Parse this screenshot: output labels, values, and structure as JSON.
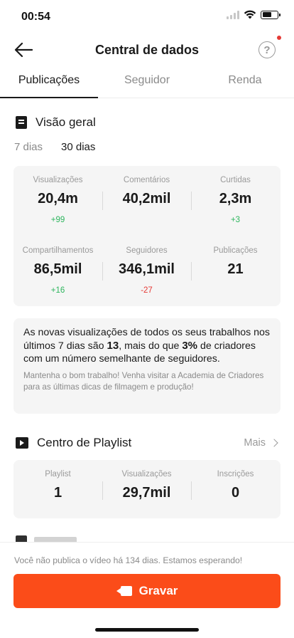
{
  "status": {
    "time": "00:54",
    "wifi_icon": "wifi-icon",
    "battery_icon": "battery-icon"
  },
  "nav": {
    "title": "Central de dados",
    "back_icon": "arrow-left-icon",
    "help_icon": "help-circle-icon",
    "help_symbol": "?"
  },
  "tabs": [
    {
      "label": "Publicações",
      "active": true
    },
    {
      "label": "Seguidor",
      "active": false
    },
    {
      "label": "Renda",
      "active": false
    }
  ],
  "overview": {
    "title": "Visão geral",
    "periods": [
      {
        "label": "7 dias",
        "active": false
      },
      {
        "label": "30 dias",
        "active": true
      }
    ],
    "stats": [
      {
        "label": "Visualizações",
        "value": "20,4m",
        "delta": "+99"
      },
      {
        "label": "Comentários",
        "value": "40,2mil",
        "delta": ""
      },
      {
        "label": "Curtidas",
        "value": "2,3m",
        "delta": "+3"
      },
      {
        "label": "Compartilhamentos",
        "value": "86,5mil",
        "delta": "+16"
      },
      {
        "label": "Seguidores",
        "value": "346,1mil",
        "delta": "-27"
      },
      {
        "label": "Publicações",
        "value": "21",
        "delta": ""
      }
    ]
  },
  "insight": {
    "part1": "As novas visualizações de todos os seus trabalhos nos últimos 7 dias são ",
    "count": "13",
    "part2": ", mais do que ",
    "percent": "3%",
    "part3": " de criadores com um número semelhante de seguidores.",
    "sub": "Mantenha o bom trabalho! Venha visitar a Academia de Criadores para as últimas dicas de filmagem e produção!"
  },
  "playlist": {
    "title": "Centro de Playlist",
    "more": "Mais",
    "stats": [
      {
        "label": "Playlist",
        "value": "1"
      },
      {
        "label": "Visualizações",
        "value": "29,7mil"
      },
      {
        "label": "Inscrições",
        "value": "0"
      }
    ]
  },
  "footer": {
    "note": "Você não publica o vídeo há 134 dias. Estamos esperando!",
    "button": "Gravar"
  },
  "colors": {
    "accent": "#fb4c19",
    "positive": "#2db55d",
    "negative": "#e53935"
  }
}
